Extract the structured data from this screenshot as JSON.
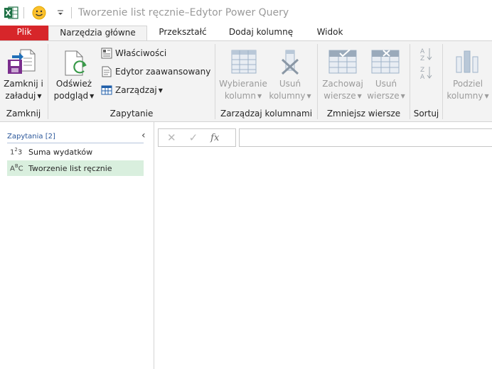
{
  "window": {
    "title": "Tworzenie list ręcznie–Edytor Power Query"
  },
  "tabs": [
    {
      "label": "Plik"
    },
    {
      "label": "Narzędzia główne"
    },
    {
      "label": "Przekształć"
    },
    {
      "label": "Dodaj kolumnę"
    },
    {
      "label": "Widok"
    }
  ],
  "ribbon": {
    "groups": [
      {
        "label": "Zamknij"
      },
      {
        "label": "Zapytanie"
      },
      {
        "label": "Zarządzaj kolumnami"
      },
      {
        "label": "Zmniejsz wiersze"
      },
      {
        "label": "Sortuj"
      }
    ],
    "close_load": {
      "line1": "Zamknij i",
      "line2": "załaduj"
    },
    "refresh": {
      "line1": "Odśwież",
      "line2": "podgląd"
    },
    "properties": "Właściwości",
    "advanced_editor": "Edytor zaawansowany",
    "manage": "Zarządzaj",
    "choose_columns": {
      "line1": "Wybieranie",
      "line2": "kolumn"
    },
    "remove_columns": {
      "line1": "Usuń",
      "line2": "kolumny"
    },
    "keep_rows": {
      "line1": "Zachowaj",
      "line2": "wiersze"
    },
    "remove_rows": {
      "line1": "Usuń",
      "line2": "wiersze"
    },
    "split_column": {
      "line1": "Podziel",
      "line2": "kolumny"
    }
  },
  "queries": {
    "header": "Zapytania [2]",
    "items": [
      {
        "type_icon": "1²3",
        "label": "Suma wydatków",
        "selected": false
      },
      {
        "type_icon": "ABC",
        "label": "Tworzenie list ręcznie",
        "selected": true
      }
    ]
  },
  "formula_bar": {
    "fx": "fx",
    "value": ""
  },
  "colors": {
    "file_tab": "#d7262a",
    "excel_green": "#1e7145",
    "selected_query": "#d9efde",
    "ribbon_bg": "#f3f3f3"
  }
}
